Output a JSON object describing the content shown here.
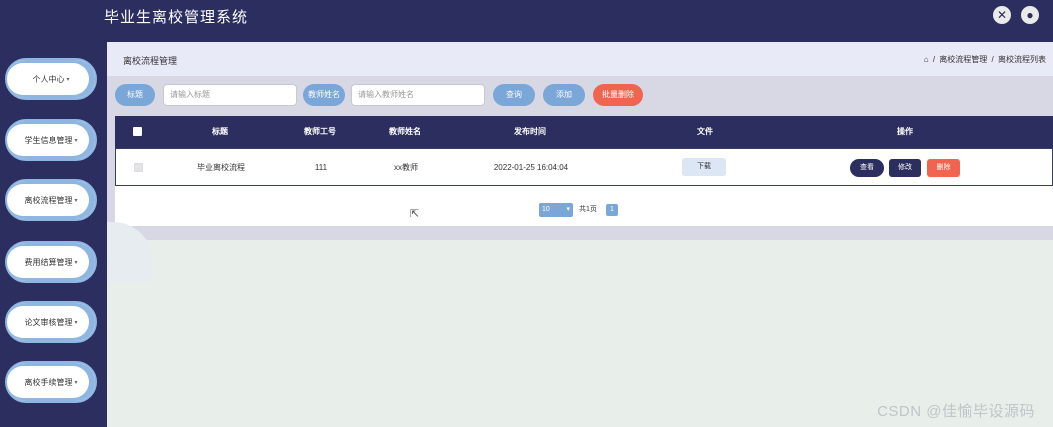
{
  "app": {
    "title": "毕业生离校管理系统"
  },
  "header_icons": {
    "close": "✕",
    "user": "●"
  },
  "sidebar": {
    "items": [
      {
        "label": "个人中心"
      },
      {
        "label": "学生信息管理"
      },
      {
        "label": "离校流程管理"
      },
      {
        "label": "费用结算管理"
      },
      {
        "label": "论文审核管理"
      },
      {
        "label": "离校手续管理"
      }
    ]
  },
  "breadcrumb": {
    "title": "离校流程管理",
    "home_icon": "⌂",
    "sep": "/",
    "path": [
      "离校流程管理",
      "离校流程列表"
    ]
  },
  "search": {
    "title_label": "标题",
    "title_placeholder": "请输入标题",
    "teacher_label": "教师姓名",
    "teacher_placeholder": "请输入教师姓名",
    "query_button": "查询",
    "add_button": "添加",
    "batch_delete_button": "批量删除"
  },
  "table": {
    "headers": [
      "标题",
      "教师工号",
      "教师姓名",
      "发布时间",
      "文件",
      "操作"
    ],
    "rows": [
      {
        "title": "毕业离校流程",
        "teacher_id": "111",
        "teacher_name": "xx教师",
        "publish_time": "2022-01-25 16:04:04",
        "file_button": "下载",
        "view_button": "查看",
        "edit_button": "修改",
        "delete_button": "删除"
      }
    ]
  },
  "pagination": {
    "page_size": "10",
    "total_text": "共1页",
    "current_page": "1"
  },
  "colors": {
    "nav": "#2b2e5e",
    "accent": "#7aa6d8",
    "danger": "#f06450"
  },
  "watermark": "CSDN @佳愉毕设源码"
}
